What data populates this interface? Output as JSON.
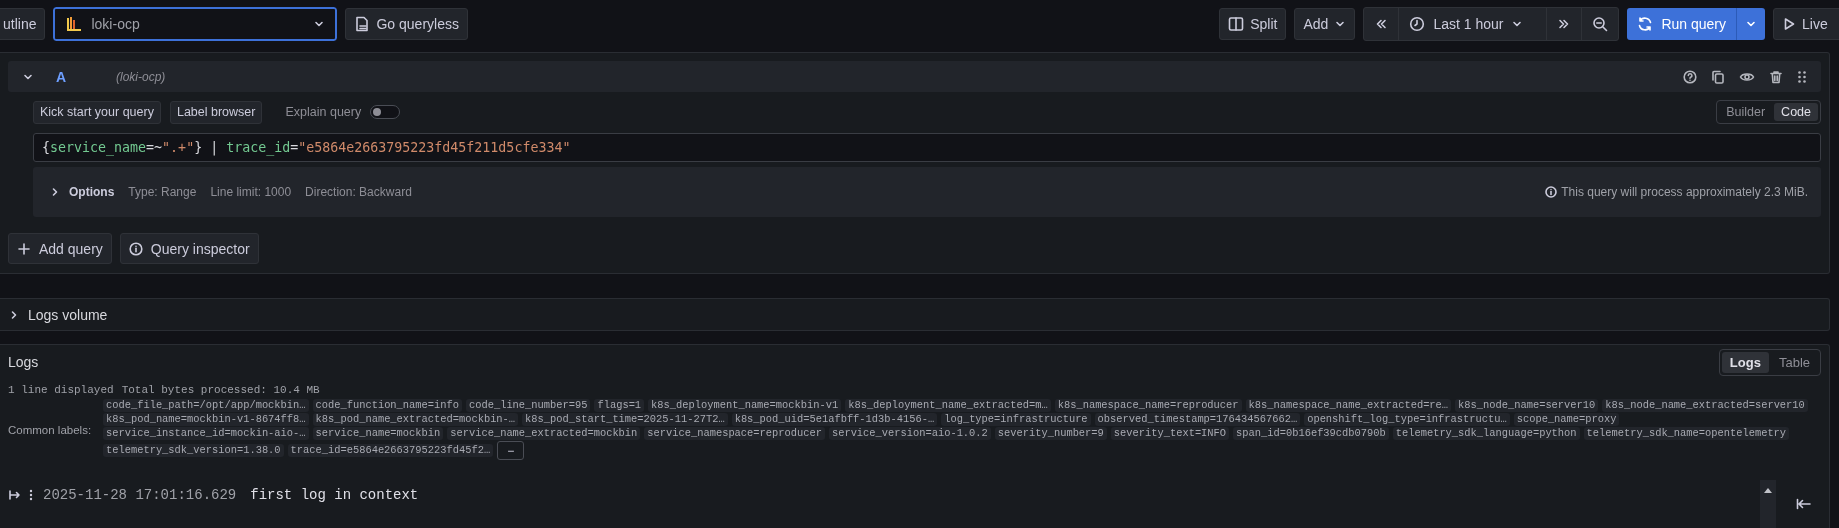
{
  "toolbar": {
    "outline_button": "utline",
    "datasource": {
      "value": "loki-ocp"
    },
    "queryless_button": "Go queryless",
    "split_button": "Split",
    "add_button": "Add",
    "time_range": "Last 1 hour",
    "run_button": "Run query",
    "live_button": "Live"
  },
  "query": {
    "ref_id": "A",
    "datasource": "(loki-ocp)",
    "expanded": true,
    "kick_start_button": "Kick start your query",
    "label_browser_button": "Label browser",
    "explain": {
      "label": "Explain query",
      "on": false
    },
    "modes": [
      {
        "label": "Builder",
        "selected": false
      },
      {
        "label": "Code",
        "selected": true
      }
    ],
    "expression": [
      {
        "kind": "punct",
        "text": "{"
      },
      {
        "kind": "label",
        "text": "service_name"
      },
      {
        "kind": "op",
        "text": "=~"
      },
      {
        "kind": "string",
        "text": "\".+\""
      },
      {
        "kind": "punct",
        "text": "} | "
      },
      {
        "kind": "label",
        "text": "trace_id"
      },
      {
        "kind": "op",
        "text": "="
      },
      {
        "kind": "string",
        "text": "\"e5864e2663795223fd45f211d5cfe334\""
      }
    ],
    "options": {
      "label": "Options",
      "expanded": false,
      "items": [
        "Type: Range",
        "Line limit: 1000",
        "Direction: Backward"
      ]
    },
    "estimate": "This query will process approximately 2.3 MiB."
  },
  "actions": [
    {
      "kind": "add",
      "label": "Add query"
    },
    {
      "kind": "inspect",
      "label": "Query inspector"
    }
  ],
  "logs_volume": {
    "title": "Logs volume",
    "expanded": false
  },
  "logs": {
    "title": "Logs",
    "views": [
      {
        "label": "Logs",
        "selected": true
      },
      {
        "label": "Table",
        "selected": false
      }
    ],
    "stats": [
      "1 line displayed",
      "Total bytes processed:  10.4 MB"
    ],
    "common_labels_title": "Common labels:",
    "common_labels": [
      "code_file_path=/opt/app/mockbin…",
      "code_function_name=info",
      "code_line_number=95",
      "flags=1",
      "k8s_deployment_name=mockbin-v1",
      "k8s_deployment_name_extracted=m…",
      "k8s_namespace_name=reproducer",
      "k8s_namespace_name_extracted=re…",
      "k8s_node_name=server10",
      "k8s_node_name_extracted=server10",
      "k8s_pod_name=mockbin-v1-8674ff8…",
      "k8s_pod_name_extracted=mockbin-…",
      "k8s_pod_start_time=2025-11-27T2…",
      "k8s_pod_uid=5e1afbff-1d3b-4156-…",
      "log_type=infrastructure",
      "observed_timestamp=176434567662…",
      "openshift_log_type=infrastructu…",
      "scope_name=proxy",
      "service_instance_id=mockin-aio-…",
      "service_name=mockbin",
      "service_name_extracted=mockbin",
      "service_namespace=reproducer",
      "service_version=aio-1.0.2",
      "severity_number=9",
      "severity_text=INFO",
      "span_id=0b16ef39cdb0790b",
      "telemetry_sdk_language=python",
      "telemetry_sdk_name=opentelemetry",
      "telemetry_sdk_version=1.38.0",
      "trace_id=e5864e2663795223fd45f2…"
    ],
    "collapse_button": "−",
    "rows": [
      {
        "time": "2025-11-28 17:01:16.629",
        "line": "first log in context"
      }
    ]
  }
}
